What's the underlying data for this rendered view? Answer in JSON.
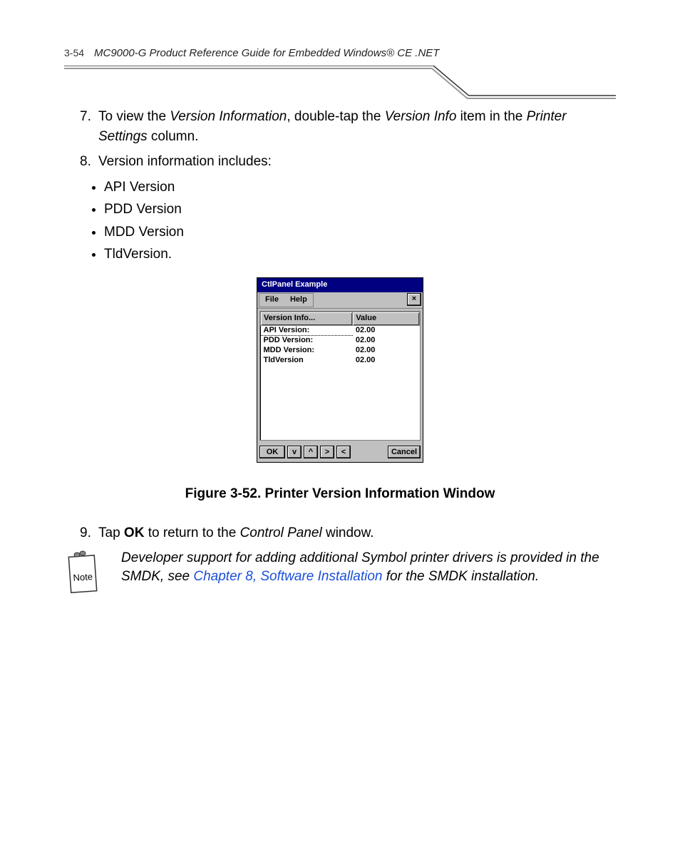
{
  "header": {
    "page_number": "3-54",
    "doc_title": "MC9000-G Product Reference Guide for Embedded Windows® CE .NET"
  },
  "steps": {
    "s7": {
      "num": "7.",
      "pre": "To view the ",
      "i1": "Version Information",
      "mid1": ", double-tap the ",
      "i2": "Version Info",
      "mid2": " item in the ",
      "i3": "Printer Settings",
      "post": " column."
    },
    "s8": {
      "num": "8.",
      "text": "Version information includes:",
      "bullets": [
        "API Version",
        "PDD Version",
        "MDD Version",
        "TldVersion."
      ]
    },
    "s9": {
      "num": "9.",
      "pre": "Tap ",
      "b1": "OK",
      "mid1": " to return to the ",
      "i1": "Control Panel",
      "post": " window."
    }
  },
  "window": {
    "title": "CtlPanel Example",
    "menu_file": "File",
    "menu_help": "Help",
    "close": "×",
    "col1": "Version Info...",
    "col2": "Value",
    "rows": [
      {
        "k": "API Version:",
        "v": "02.00"
      },
      {
        "k": "PDD Version:",
        "v": "02.00"
      },
      {
        "k": "MDD Version:",
        "v": "02.00"
      },
      {
        "k": "TldVersion",
        "v": "02.00"
      }
    ],
    "btn_ok": "OK",
    "btn_down": "v",
    "btn_up": "^",
    "btn_right": ">",
    "btn_left": "<",
    "btn_cancel": "Cancel"
  },
  "figure_caption": "Figure 3-52.  Printer Version Information Window",
  "note": {
    "label": "Note",
    "pre": "Developer support for adding additional Symbol printer drivers is provided in the SMDK, see ",
    "link": "Chapter 8, Software Installation",
    "post": " for the SMDK installation."
  }
}
